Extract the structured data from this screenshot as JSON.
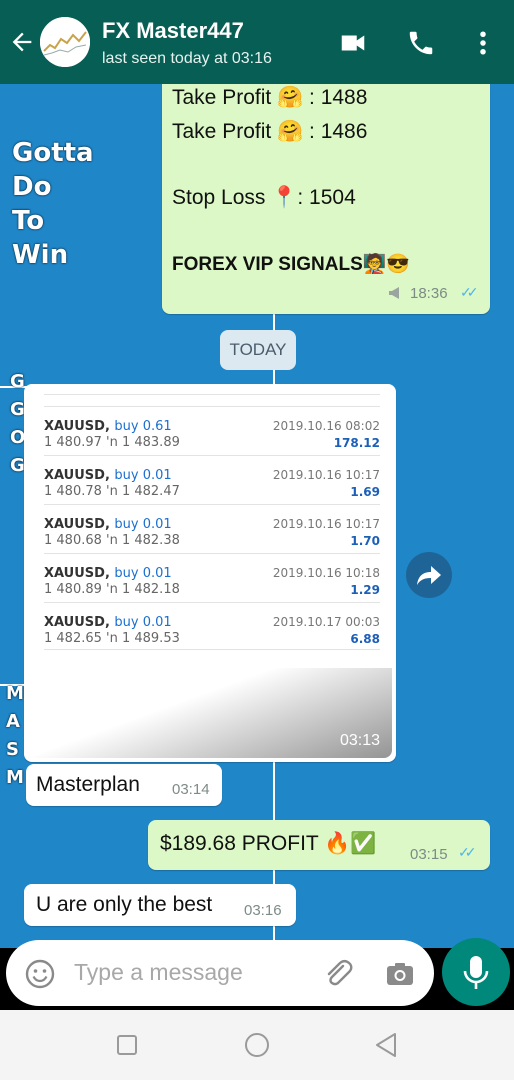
{
  "header": {
    "title": "FX Master447",
    "subtitle": "last seen today at 03:16",
    "bg_color": "#075e54"
  },
  "wallpaper": {
    "lines": [
      "Gotta",
      "Do",
      "To",
      "Win"
    ],
    "side_letters_1": [
      "G",
      "G",
      "O",
      "G"
    ],
    "side_letters_2": [
      "M",
      "A",
      "S",
      "M"
    ]
  },
  "messages": {
    "signal": {
      "tp1": "Take Profit 🤗 : 1488",
      "tp2": "Take Profit 🤗 : 1486",
      "sl": "Stop Loss 📍: 1504",
      "footer": "FOREX VIP SIGNALS🧑‍🏫😎",
      "time": "18:36"
    },
    "date_divider": "TODAY",
    "trades": [
      {
        "symbol": "XAUUSD,",
        "action": "buy 0.61",
        "prices": "1 480.97 'n  1 483.89",
        "datetime": "2019.10.16 08:02",
        "profit": "178.12"
      },
      {
        "symbol": "XAUUSD,",
        "action": "buy 0.01",
        "prices": "1 480.78 'n  1 482.47",
        "datetime": "2019.10.16 10:17",
        "profit": "1.69"
      },
      {
        "symbol": "XAUUSD,",
        "action": "buy 0.01",
        "prices": "1 480.68 'n  1 482.38",
        "datetime": "2019.10.16 10:17",
        "profit": "1.70"
      },
      {
        "symbol": "XAUUSD,",
        "action": "buy 0.01",
        "prices": "1 480.89 'n  1 482.18",
        "datetime": "2019.10.16 10:18",
        "profit": "1.29"
      },
      {
        "symbol": "XAUUSD,",
        "action": "buy 0.01",
        "prices": "1 482.65 'n  1 489.53",
        "datetime": "2019.10.17 00:03",
        "profit": "6.88"
      }
    ],
    "card_time": "03:13",
    "m1": {
      "text": "Masterplan",
      "time": "03:14"
    },
    "m2": {
      "text": "$189.68 PROFIT 🔥✅",
      "time": "03:15"
    },
    "m3": {
      "text": "U are only the best",
      "time": "03:16"
    }
  },
  "composer": {
    "placeholder": "Type a message"
  },
  "colors": {
    "chat_bg": "#1f86c8",
    "outgoing": "#dcf8c6",
    "incoming": "#ffffff",
    "accent": "#00897b"
  }
}
